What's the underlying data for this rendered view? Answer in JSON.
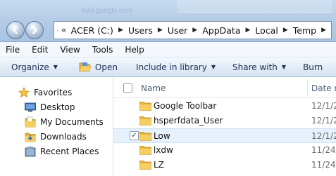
{
  "titlebar": {
    "ghost_text": "mail.google.com"
  },
  "address": {
    "overflow_chevron": "«",
    "crumbs": [
      "ACER (C:)",
      "Users",
      "User",
      "AppData",
      "Local",
      "Temp"
    ]
  },
  "menu": {
    "items": [
      "File",
      "Edit",
      "View",
      "Tools",
      "Help"
    ]
  },
  "commands": {
    "organize": "Organize",
    "open": "Open",
    "include": "Include in library",
    "share": "Share with",
    "burn": "Burn"
  },
  "nav": {
    "favorites": "Favorites",
    "items": [
      "Desktop",
      "My Documents",
      "Downloads",
      "Recent Places"
    ]
  },
  "columns": {
    "name": "Name",
    "date": "Date m"
  },
  "files": [
    {
      "name": "Google Toolbar",
      "date": "12/1/2",
      "checked": false
    },
    {
      "name": "hsperfdata_User",
      "date": "12/1/2",
      "checked": false
    },
    {
      "name": "Low",
      "date": "12/1/2",
      "checked": true
    },
    {
      "name": "lxdw",
      "date": "11/24/",
      "checked": false
    },
    {
      "name": "LZ",
      "date": "11/24/",
      "checked": false
    }
  ],
  "colors": {
    "folder": "#e8b43b",
    "selection": "#e7f1fc",
    "header_text": "#4c607a"
  }
}
